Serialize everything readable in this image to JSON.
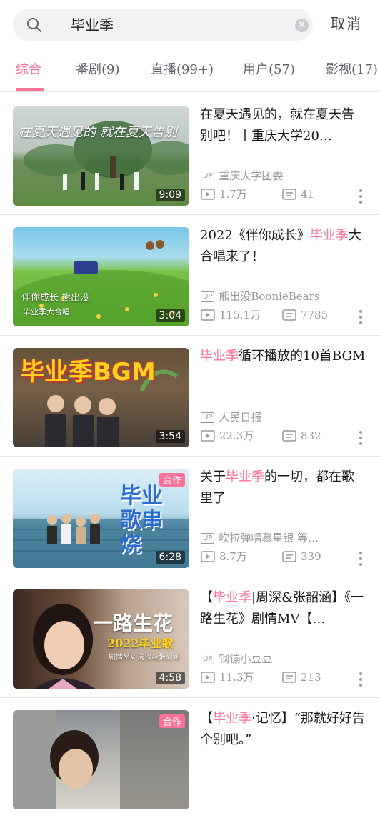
{
  "search": {
    "query": "毕业季",
    "cancel_label": "取消"
  },
  "tabs": [
    {
      "label": "综合"
    },
    {
      "label": "番剧(9)"
    },
    {
      "label": "直播(99+)"
    },
    {
      "label": "用户(57)"
    },
    {
      "label": "影视(17)"
    }
  ],
  "results": [
    {
      "title_parts": [
        "在夏天遇见的，就在夏天告别吧！丨重庆大学20…"
      ],
      "author": "重庆大学团委",
      "views": "1.7万",
      "danmaku": "41",
      "duration": "9:09",
      "overlay": "在夏天遇见的 就在夏天告别"
    },
    {
      "title_pre": "2022《伴你成长》",
      "title_hl": "毕业季",
      "title_post": "大合唱来了！",
      "author": "熊出没BoonieBears",
      "views": "115.1万",
      "danmaku": "7785",
      "duration": "3:04",
      "overlay_1": "伴你成长 熊出没",
      "overlay_2": "毕业季大合唱"
    },
    {
      "title_hl": "毕业季",
      "title_post": "循环播放的10首BGM",
      "author": "人民日报",
      "views": "22.3万",
      "danmaku": "832",
      "duration": "3:54",
      "overlay": "毕业季BGM"
    },
    {
      "title_pre": "关于",
      "title_hl": "毕业季",
      "title_post": "的一切，都在歌里了",
      "author": "吹拉弹唱慕星银 等…",
      "views": "8.7万",
      "danmaku": "339",
      "duration": "6:28",
      "badge": "合作",
      "overlay": "毕业歌串烧"
    },
    {
      "title_pre": "【",
      "title_hl": "毕业季",
      "title_post": "|周深&张韶涵】《一路生花》剧情MV【…",
      "author": "钢镚小豆豆",
      "views": "11.3万",
      "danmaku": "213",
      "duration": "4:58",
      "overlay_1": "一路生花",
      "overlay_2": "2022毕业歌",
      "overlay_3": "剧情MV 周深&张韶涵"
    },
    {
      "title_pre": "【",
      "title_hl": "毕业季",
      "title_post": "·记忆】“那就好好告个别吧。”",
      "badge": "合作"
    }
  ],
  "colors": {
    "accent": "#fb7299",
    "muted": "#9499a0"
  }
}
